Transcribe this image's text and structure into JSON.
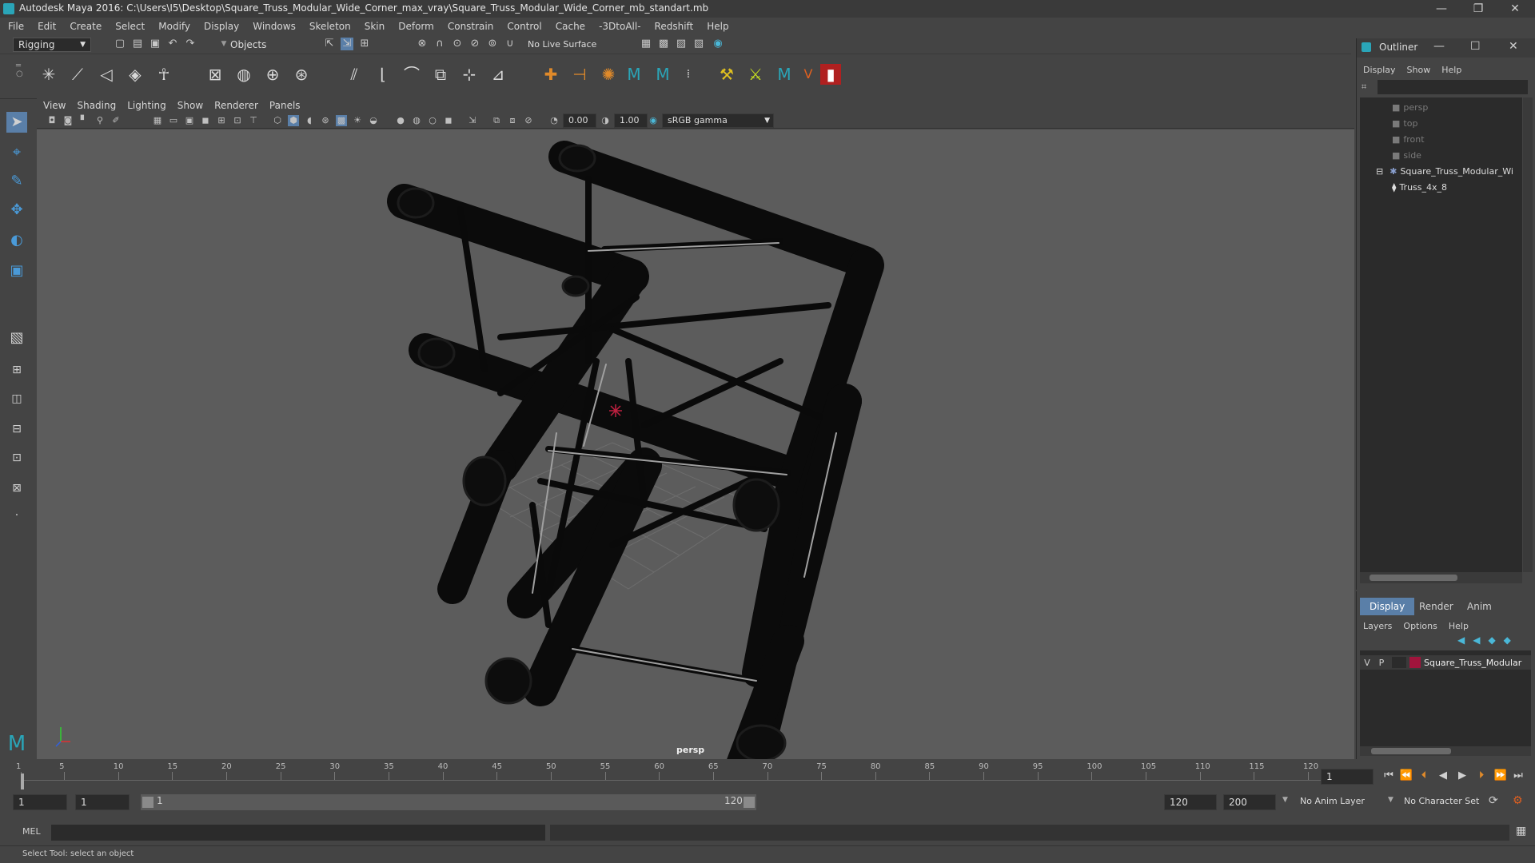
{
  "window": {
    "title": "Autodesk Maya 2016: C:\\Users\\I5\\Desktop\\Square_Truss_Modular_Wide_Corner_max_vray\\Square_Truss_Modular_Wide_Corner_mb_standart.mb",
    "minimize": "—",
    "restore": "❐",
    "close": "✕"
  },
  "menubar": [
    "File",
    "Edit",
    "Create",
    "Select",
    "Modify",
    "Display",
    "Windows",
    "Skeleton",
    "Skin",
    "Deform",
    "Constrain",
    "Control",
    "Cache",
    "-3DtoAll-",
    "Redshift",
    "Help"
  ],
  "statusline": {
    "mode": "Rigging",
    "selection_mask": "Objects",
    "live_surface": "No Live Surface"
  },
  "viewport": {
    "menu": [
      "View",
      "Shading",
      "Lighting",
      "Show",
      "Renderer",
      "Panels"
    ],
    "exposure": "0.00",
    "gamma": "1.00",
    "color_space": "sRGB gamma",
    "camera_label": "persp"
  },
  "outliner": {
    "title": "Outliner",
    "menu": [
      "Display",
      "Show",
      "Help"
    ],
    "items": [
      {
        "label": "persp",
        "depth": 1,
        "type": "camera"
      },
      {
        "label": "top",
        "depth": 1,
        "type": "camera"
      },
      {
        "label": "front",
        "depth": 1,
        "type": "camera"
      },
      {
        "label": "side",
        "depth": 1,
        "type": "camera"
      },
      {
        "label": "Square_Truss_Modular_Wi",
        "depth": 1,
        "type": "group"
      },
      {
        "label": "Truss_4x_8",
        "depth": 2,
        "type": "mesh"
      }
    ]
  },
  "layer_editor": {
    "tabs": [
      "Display",
      "Render",
      "Anim"
    ],
    "active_tab": "Display",
    "menu": [
      "Layers",
      "Options",
      "Help"
    ],
    "layer": {
      "v": "V",
      "p": "P",
      "name": "Square_Truss_Modular",
      "color": "#a0143c"
    }
  },
  "timeline": {
    "ticks": [
      "1",
      "5",
      "10",
      "15",
      "20",
      "25",
      "30",
      "35",
      "40",
      "45",
      "50",
      "55",
      "60",
      "65",
      "70",
      "75",
      "80",
      "85",
      "90",
      "95",
      "100",
      "105",
      "110",
      "115",
      "120"
    ],
    "current_frame": "1"
  },
  "range": {
    "start": "1",
    "playback_start": "1",
    "slider_start": "1",
    "slider_end": "120",
    "playback_end": "120",
    "end": "200",
    "anim_layer": "No Anim Layer",
    "character_set": "No Character Set"
  },
  "command_line": {
    "language": "MEL"
  },
  "help_line": {
    "text": "Select Tool: select an object"
  }
}
